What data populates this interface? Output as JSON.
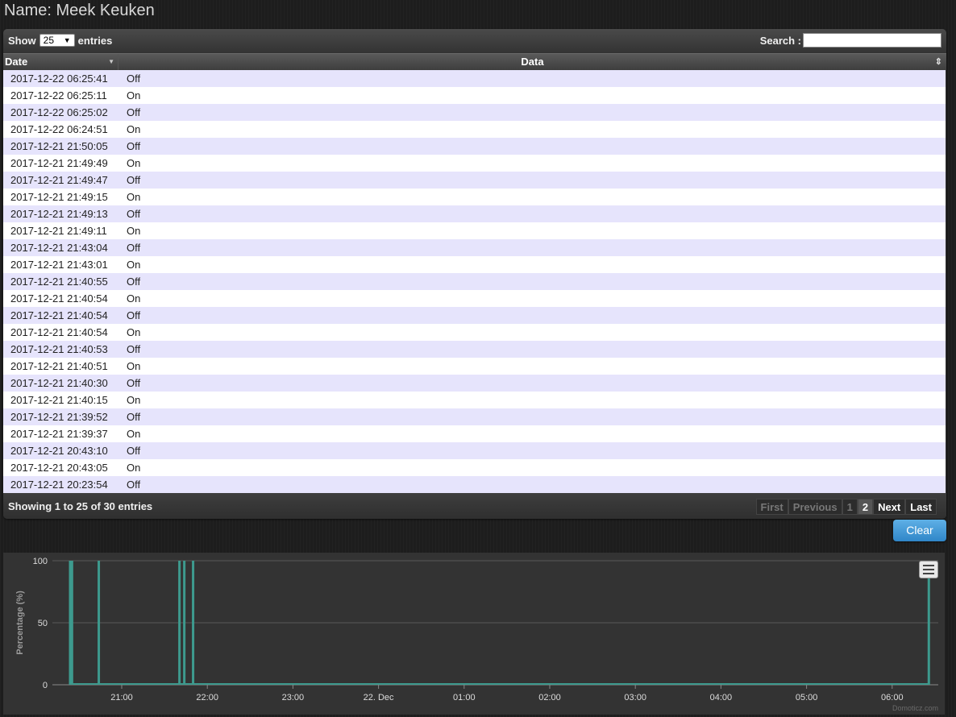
{
  "page": {
    "title": "Name: Meek Keuken"
  },
  "table": {
    "show_label": "Show",
    "entries_label": "entries",
    "page_length": "25",
    "search_label": "Search :",
    "search_value": "",
    "columns": [
      "Date",
      "Data"
    ],
    "rows": [
      [
        "2017-12-22 06:25:41",
        "Off"
      ],
      [
        "2017-12-22 06:25:11",
        "On"
      ],
      [
        "2017-12-22 06:25:02",
        "Off"
      ],
      [
        "2017-12-22 06:24:51",
        "On"
      ],
      [
        "2017-12-21 21:50:05",
        "Off"
      ],
      [
        "2017-12-21 21:49:49",
        "On"
      ],
      [
        "2017-12-21 21:49:47",
        "Off"
      ],
      [
        "2017-12-21 21:49:15",
        "On"
      ],
      [
        "2017-12-21 21:49:13",
        "Off"
      ],
      [
        "2017-12-21 21:49:11",
        "On"
      ],
      [
        "2017-12-21 21:43:04",
        "Off"
      ],
      [
        "2017-12-21 21:43:01",
        "On"
      ],
      [
        "2017-12-21 21:40:55",
        "Off"
      ],
      [
        "2017-12-21 21:40:54",
        "On"
      ],
      [
        "2017-12-21 21:40:54",
        "Off"
      ],
      [
        "2017-12-21 21:40:54",
        "On"
      ],
      [
        "2017-12-21 21:40:53",
        "Off"
      ],
      [
        "2017-12-21 21:40:51",
        "On"
      ],
      [
        "2017-12-21 21:40:30",
        "Off"
      ],
      [
        "2017-12-21 21:40:15",
        "On"
      ],
      [
        "2017-12-21 21:39:52",
        "Off"
      ],
      [
        "2017-12-21 21:39:37",
        "On"
      ],
      [
        "2017-12-21 20:43:10",
        "Off"
      ],
      [
        "2017-12-21 20:43:05",
        "On"
      ],
      [
        "2017-12-21 20:23:54",
        "Off"
      ]
    ],
    "info": "Showing 1 to 25 of 30 entries",
    "pager": {
      "first": "First",
      "previous": "Previous",
      "page1": "1",
      "page2": "2",
      "next": "Next",
      "last": "Last"
    }
  },
  "clear_button": "Clear",
  "chart": {
    "credit": "Domoticz.com",
    "menu_icon": "hamburger-menu-icon"
  },
  "colors": {
    "series": "#3d9a8e",
    "clear_button": "#3a90d0",
    "odd_row": "#e6e4fc"
  },
  "chart_data": {
    "type": "area",
    "ylabel": "Percentage (%)",
    "ylim": [
      0,
      100
    ],
    "yticks": [
      "0",
      "50",
      "100"
    ],
    "xticks": [
      {
        "t": "2017-12-21 21:00",
        "label": "21:00"
      },
      {
        "t": "2017-12-21 22:00",
        "label": "22:00"
      },
      {
        "t": "2017-12-21 23:00",
        "label": "23:00"
      },
      {
        "t": "2017-12-22 00:00",
        "label": "22. Dec"
      },
      {
        "t": "2017-12-22 01:00",
        "label": "01:00"
      },
      {
        "t": "2017-12-22 02:00",
        "label": "02:00"
      },
      {
        "t": "2017-12-22 03:00",
        "label": "03:00"
      },
      {
        "t": "2017-12-22 04:00",
        "label": "04:00"
      },
      {
        "t": "2017-12-22 05:00",
        "label": "05:00"
      },
      {
        "t": "2017-12-22 06:00",
        "label": "06:00"
      }
    ],
    "grid": true,
    "series": [
      {
        "on_intervals": [
          [
            "2017-12-21 20:23:00",
            "2017-12-21 20:26:00"
          ],
          [
            "2017-12-21 20:43:05",
            "2017-12-21 20:43:10"
          ],
          [
            "2017-12-21 21:39:37",
            "2017-12-21 21:41:00"
          ],
          [
            "2017-12-21 21:43:01",
            "2017-12-21 21:43:04"
          ],
          [
            "2017-12-21 21:49:11",
            "2017-12-21 21:50:05"
          ],
          [
            "2017-12-22 06:24:51",
            "2017-12-22 06:25:41"
          ]
        ]
      }
    ]
  }
}
